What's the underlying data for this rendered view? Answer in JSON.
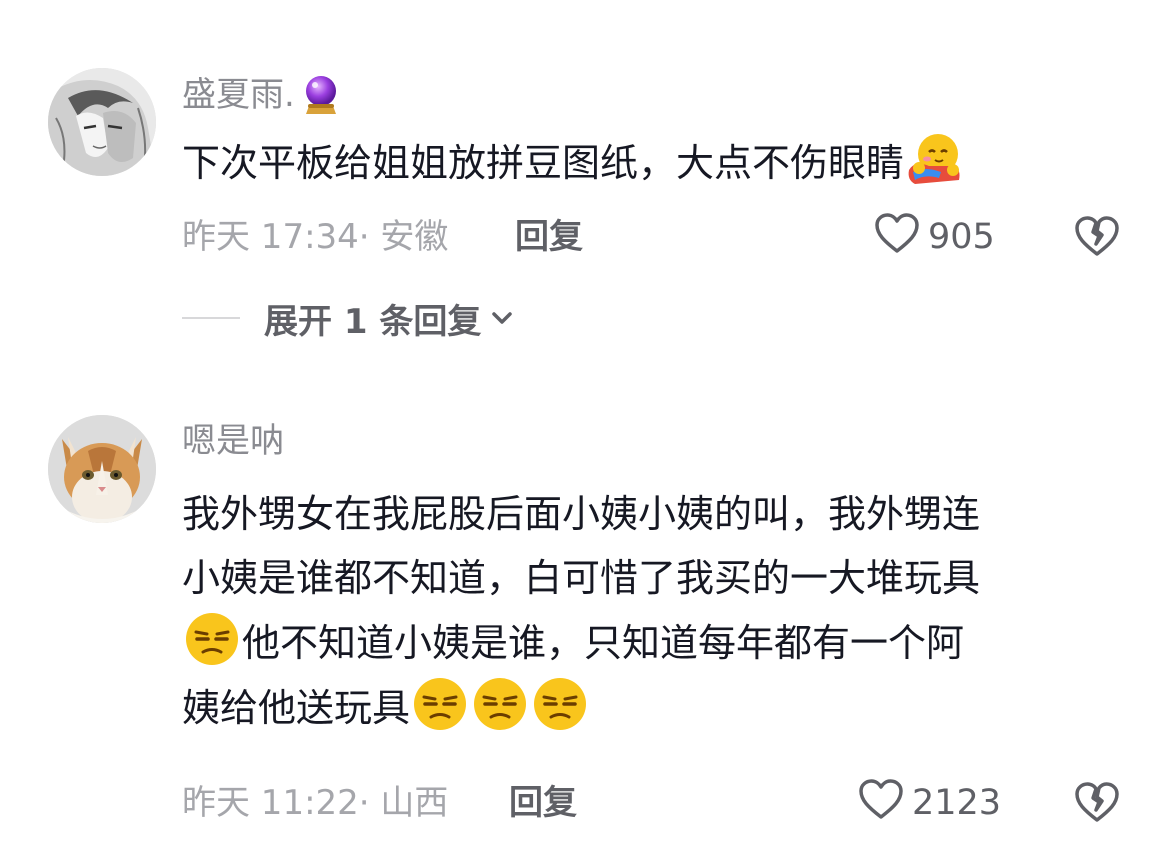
{
  "comments": [
    {
      "username": "盛夏雨.",
      "username_icon": "crystal-ball-icon",
      "content_before_emoji": "下次平板给姐姐放拼豆图纸，大点不伤眼睛",
      "content_emoji": "hugging-face-emoji",
      "time_location": "昨天 17:34· 安徽",
      "reply_label": "回复",
      "like_count": "905",
      "expand_label": "展开 1 条回复"
    },
    {
      "username": "嗯是呐",
      "content_line1": "我外甥女在我屁股后面小姨小姨的叫，我外甥连",
      "content_line2": "小姨是谁都不知道，白可惜了我买的一大堆玩具",
      "content_line3": "他不知道小姨是谁，只知道每年都有一个阿",
      "content_line4": "姨给他送玩具",
      "content_emoji": "unamused-face-emoji",
      "time_location": "昨天 11:22· 山西",
      "reply_label": "回复",
      "like_count": "2123"
    }
  ],
  "colors": {
    "text_primary": "#161823",
    "text_secondary": "#8a8b91",
    "meta": "#a5a6ab",
    "action": "#5f6066",
    "emoji_yellow": "#f9c51c"
  }
}
